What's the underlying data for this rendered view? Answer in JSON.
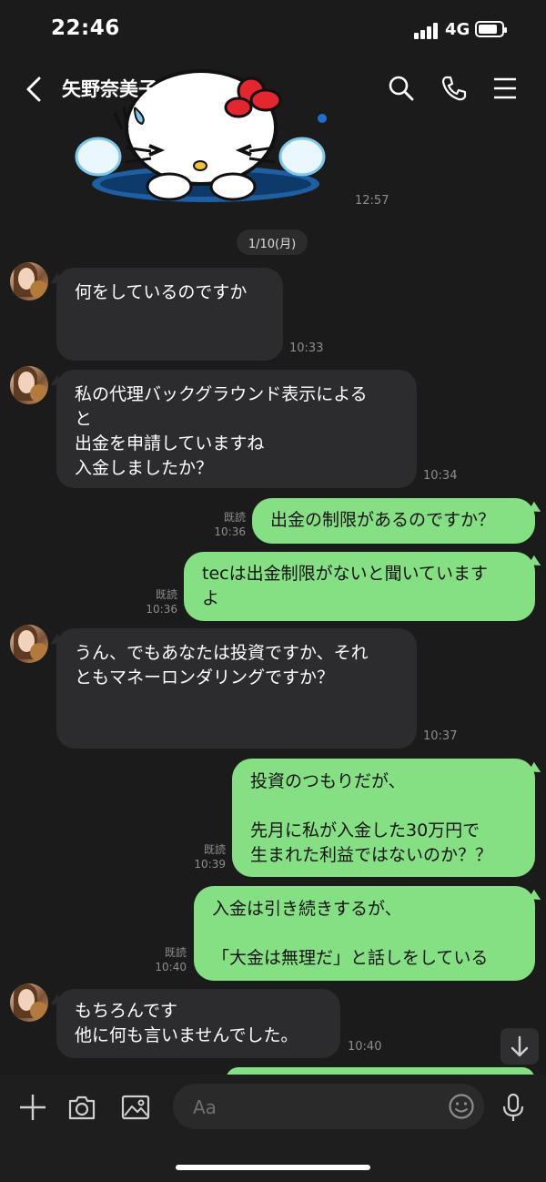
{
  "status_bar": {
    "time": "22:46",
    "network": "4G"
  },
  "header": {
    "title": "矢野奈美子"
  },
  "sticker": {
    "time": "12:57"
  },
  "date_divider": "1/10(月)",
  "messages": [
    {
      "text": "何をしているのですか",
      "time": "10:33"
    },
    {
      "text": "私の代理バックグラウンド表示による\nと\n出金を申請していますね\n入金しましたか？",
      "time": "10:34"
    },
    {
      "text": "出金の制限があるのですか？",
      "time": "10:36",
      "read": "既読"
    },
    {
      "text": "tecは出金制限がないと聞いています\nよ",
      "time": "10:36",
      "read": "既読"
    },
    {
      "text": "うん、でもあなたは投資ですか、それ\nともマネーロンダリングですか？",
      "time": "10:37"
    },
    {
      "text": "投資のつもりだが、\n\n先月に私が入金した30万円で\n生まれた利益ではないのか？？",
      "time": "10:39",
      "read": "既読"
    },
    {
      "text": "入金は引き続きするが、\n\n「大金は無理だ」と話しをしている",
      "time": "10:40",
      "read": "既読"
    },
    {
      "text": "もちろんです\n他に何も言いませんでした。",
      "time": "10:40"
    }
  ],
  "input": {
    "placeholder": "Aa"
  }
}
